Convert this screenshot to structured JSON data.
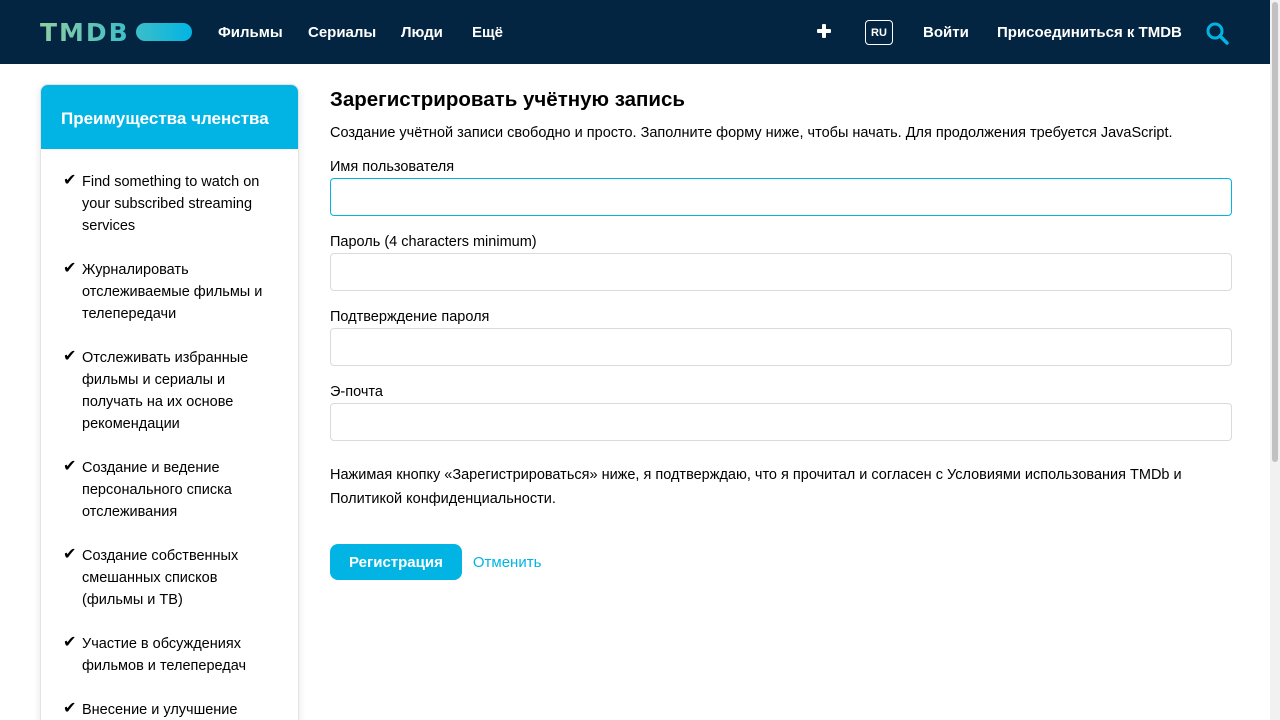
{
  "header": {
    "logo_text": "TMDB",
    "nav": [
      "Фильмы",
      "Сериалы",
      "Люди",
      "Ещё"
    ],
    "lang": "RU",
    "login": "Войти",
    "join": "Присоединиться к TMDB"
  },
  "sidebar": {
    "title": "Преимущества членства",
    "items": [
      "Find something to watch on your subscribed streaming services",
      "Журналировать отслеживаемые фильмы и телепередачи",
      "Отслеживать избранные фильмы и сериалы и получать на их основе рекомендации",
      "Создание и ведение персонального списка отслеживания",
      "Создание собственных смешанных списков (фильмы и ТВ)",
      "Участие в обсуждениях фильмов и телепередач",
      "Внесение и улучшение"
    ]
  },
  "form": {
    "title": "Зарегистрировать учётную запись",
    "intro": "Создание учётной записи свободно и просто. Заполните форму ниже, чтобы начать. Для продолжения требуется JavaScript.",
    "username_label": "Имя пользователя",
    "password_label": "Пароль (4 characters minimum)",
    "confirm_label": "Подтверждение пароля",
    "email_label": "Э-почта",
    "username_value": "",
    "password_value": "",
    "confirm_value": "",
    "email_value": "",
    "terms": "Нажимая кнопку «Зарегистрироваться» ниже, я подтверждаю, что я прочитал и согласен с Условиями использования TMDb и Политикой конфиденциальности.",
    "submit": "Регистрация",
    "cancel": "Отменить"
  },
  "colors": {
    "header_bg": "#032541",
    "accent": "#01b4e4"
  }
}
